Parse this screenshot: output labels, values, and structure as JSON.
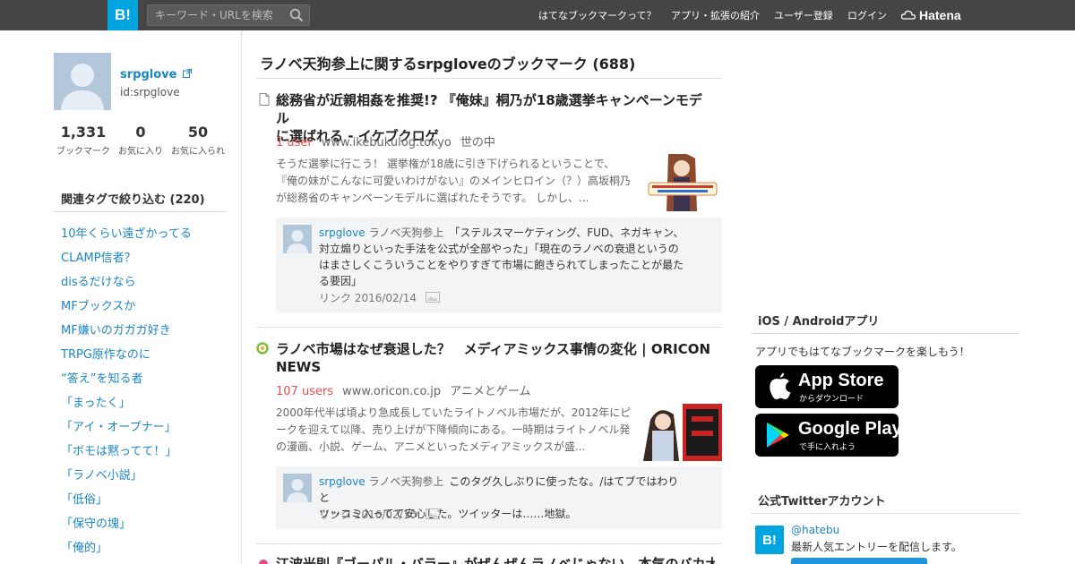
{
  "header": {
    "logo": "B!",
    "search_placeholder": "キーワード・URLを検索",
    "nav": [
      "はてなブックマークって？",
      "アプリ・拡張の紹介",
      "ユーザー登録",
      "ログイン"
    ],
    "hatena": "Hatena"
  },
  "profile": {
    "name": "srpglove",
    "id": "id:srpglove",
    "stats": [
      {
        "num": "1,331",
        "label": "ブックマーク"
      },
      {
        "num": "0",
        "label": "お気に入り"
      },
      {
        "num": "50",
        "label": "お気に入られ"
      }
    ]
  },
  "tags": {
    "title": "関連タグで絞り込む (220)",
    "items": [
      "10年くらい遠ざかってる",
      "CLAMP信者？",
      "disるだけなら",
      "MFブックスか",
      "MF嫌いのガガガ好き",
      "TRPG原作なのに",
      "“答え”を知る者",
      "「まったく」",
      "「アイ・オープナー」",
      "「ボモは黙ってて！」",
      "「ラノベ小説」",
      "「低俗」",
      "「保守の塊」",
      "「俺的」"
    ]
  },
  "main": {
    "title": "ラノベ天狗参上に関するsrpgloveのブックマーク (688)",
    "entries": [
      {
        "title_line1": "総務省が近親相姦を推奨!? 『俺妹』桐乃が18歳選挙キャンペーンモデル",
        "title_line2": "に選ばれる - イケブクロゲ",
        "users": "1 user",
        "domain": "www.ikebukulog.tokyo",
        "category": "世の中",
        "summary_line1": "そうだ選挙に行こう！ 選挙権が18歳に引き下げられるということで、",
        "summary_line2": "『俺の妹がこんなに可愛いわけがない』のメインヒロイン（？）高坂桐乃",
        "summary_line3": "が総務省のキャンペーンモデルに選ばれたそうです。 しかし、...",
        "comment": {
          "user": "srpglove",
          "tag": "ラノベ天狗参上",
          "line1": "「ステルスマーケティング、FUD、ネガキャン、",
          "line2": "対立煽りといった手法を公式が全部やった」「現在のラノベの衰退というの",
          "line3": "はまさしくこういうことをやりすぎて市場に飽きられてしまったことが最た",
          "line4": "る要因」",
          "footer": "リンク 2016/02/14"
        }
      },
      {
        "title_line1": "ラノベ市場はなぜ衰退した？　メディアミックス事情の変化 | ORICON",
        "title_line2": "NEWS",
        "users": "107 users",
        "domain": "www.oricon.co.jp",
        "category": "アニメとゲーム",
        "summary_line1": "2000年代半ば頃より急成長していたライトノベル市場だが、2012年にピ",
        "summary_line2": "ークを迎えて以降、売り上げが下降傾向にある。一時期はライトノベル発",
        "summary_line3": "の漫画、小説、ゲーム、アニメといったメディアミックスが盛...",
        "comment": {
          "user": "srpglove",
          "tag": "ラノベ天狗参上",
          "line1": "このタグ久しぶりに使ったな。/はてブではわりと",
          "line2": "ツッコミ入ってて安心した。ツイッターは……地獄。",
          "footer": "リンク 2016/02/10"
        }
      },
      {
        "title_line1": "江波光則『ゴーパル・バラー』がぜんぜんラノベじゃない、本気のバカ大ス"
      }
    ]
  },
  "right": {
    "apps_title": "iOS / Androidアプリ",
    "apps_text": "アプリでもはてなブックマークを楽しもう！",
    "appstore_big": "App Store",
    "appstore_small": "からダウンロード",
    "googleplay_big": "Google Play",
    "googleplay_small": "で手に入れよう",
    "twitter_title": "公式Twitterアカウント",
    "twitter_handle": "@hatebu",
    "twitter_desc": "最新人気エントリーを配信します。"
  },
  "colors": {
    "accent": "#00a4de",
    "link": "#1b86c4",
    "users": "#e8504c",
    "header": "#454545"
  }
}
